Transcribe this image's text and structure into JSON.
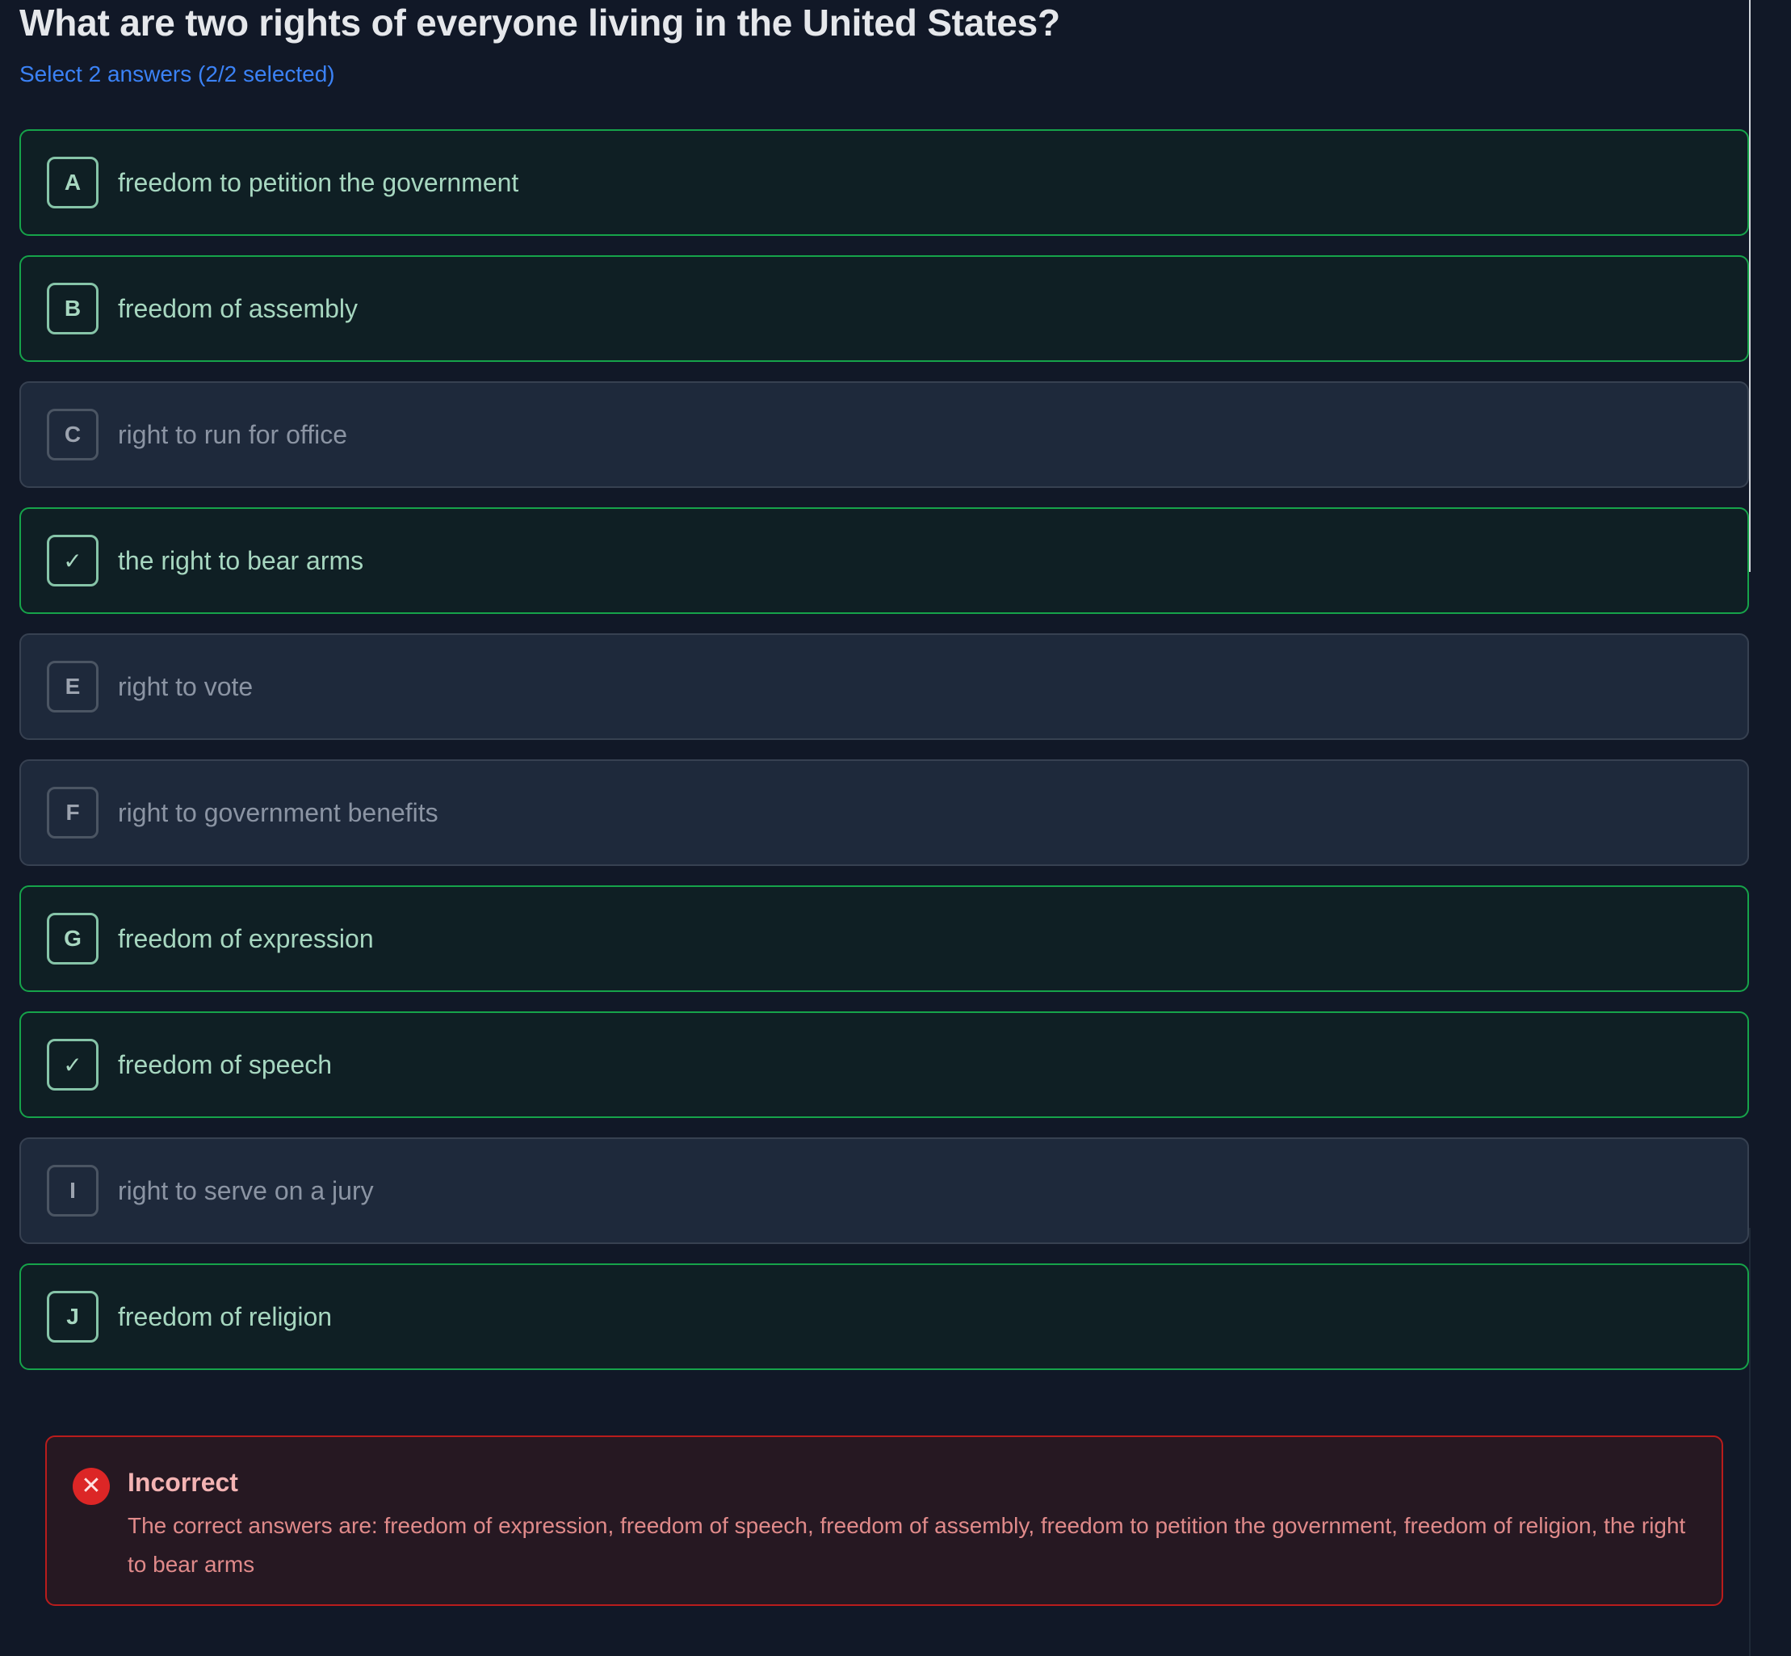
{
  "question": {
    "title": "What are two rights of everyone living in the United States?",
    "instruction": "Select 2 answers (2/2 selected)"
  },
  "options": [
    {
      "marker": "A",
      "label": "freedom to petition the government",
      "state": "correct"
    },
    {
      "marker": "B",
      "label": "freedom of assembly",
      "state": "correct"
    },
    {
      "marker": "C",
      "label": "right to run for office",
      "state": "neutral"
    },
    {
      "marker": "✓",
      "label": "the right to bear arms",
      "state": "correct-selected"
    },
    {
      "marker": "E",
      "label": "right to vote",
      "state": "neutral"
    },
    {
      "marker": "F",
      "label": "right to government benefits",
      "state": "neutral"
    },
    {
      "marker": "G",
      "label": "freedom of expression",
      "state": "correct"
    },
    {
      "marker": "✓",
      "label": "freedom of speech",
      "state": "correct-selected"
    },
    {
      "marker": "I",
      "label": "right to serve on a jury",
      "state": "neutral"
    },
    {
      "marker": "J",
      "label": "freedom of religion",
      "state": "correct"
    }
  ],
  "result": {
    "icon": "x-circle-icon",
    "title": "Incorrect",
    "text": "The correct answers are: freedom of expression, freedom of speech, freedom of assembly, freedom to petition the government, freedom of religion, the right to bear arms"
  },
  "colors": {
    "background": "#111827",
    "correct_border": "#16a34a",
    "neutral_border": "#374151",
    "error_border": "#b91c1c",
    "accent": "#3b82f6"
  }
}
